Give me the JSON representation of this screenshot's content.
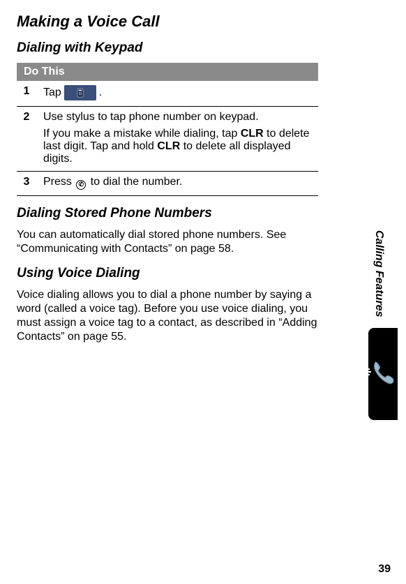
{
  "title": "Making a Voice Call",
  "sections": {
    "keypad": {
      "heading": "Dialing with Keypad",
      "tableHeader": "Do This",
      "steps": {
        "one": {
          "num": "1",
          "pre": "Tap ",
          "post": "."
        },
        "two": {
          "num": "2",
          "line": "Use stylus to tap phone number on keypad.",
          "para_a": "If you make a mistake while dialing, tap ",
          "clr1": "CLR",
          "para_b": " to delete last digit. Tap and hold ",
          "clr2": "CLR",
          "para_c": " to delete all displayed digits."
        },
        "three": {
          "num": "3",
          "pre": "Press ",
          "post": " to dial the number."
        }
      }
    },
    "stored": {
      "heading": "Dialing Stored Phone Numbers",
      "body": "You can automatically dial stored phone numbers. See “Communicating with Contacts” on page 58."
    },
    "voice": {
      "heading": "Using Voice Dialing",
      "body": "Voice dialing allows you to dial a phone number by saying a word (called a voice tag). Before you use voice dialing, you must assign a voice tag to a contact, as described in “Adding Contacts” on page 55."
    }
  },
  "sideTab": "Calling Features",
  "pageNumber": "39",
  "icons": {
    "tap": "phone-keypad-icon",
    "send": "send-key-icon",
    "sidePhone": "telephone-icon"
  }
}
